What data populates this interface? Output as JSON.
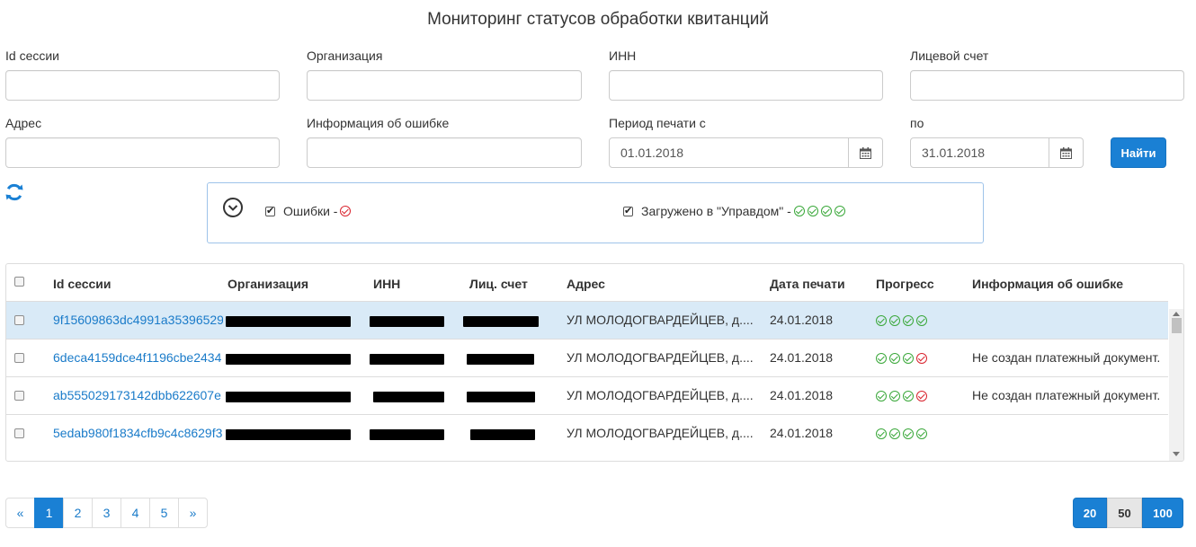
{
  "page": {
    "title": "Мониторинг статусов обработки квитанций"
  },
  "filters": {
    "session_id_label": "Id сессии",
    "org_label": "Организация",
    "inn_label": "ИНН",
    "account_label": "Лицевой счет",
    "address_label": "Адрес",
    "error_info_label": "Информация об ошибке",
    "period_from_label": "Период печати с",
    "period_to_label": "по",
    "date_from": "01.01.2018",
    "date_to": "31.01.2018",
    "find_label": "Найти"
  },
  "legend": {
    "errors_label": "Ошибки -",
    "uploaded_label": "Загружено в \"Управдом\" -"
  },
  "table": {
    "headers": {
      "session_id": "Id сессии",
      "org": "Организация",
      "inn": "ИНН",
      "account": "Лиц. счет",
      "address": "Адрес",
      "print_date": "Дата печати",
      "progress": "Прогресс",
      "error_info": "Информация об ошибке"
    },
    "rows": [
      {
        "session_id": "9f15609863dc4991a35396529",
        "address": "УЛ МОЛОДОГВАРДЕЙЦЕВ, д....",
        "print_date": "24.01.2018",
        "progress": [
          "ok",
          "ok",
          "ok",
          "ok"
        ],
        "error_info": ""
      },
      {
        "session_id": "6deca4159dce4f1196cbe2434",
        "address": "УЛ МОЛОДОГВАРДЕЙЦЕВ, д....",
        "print_date": "24.01.2018",
        "progress": [
          "ok",
          "ok",
          "ok",
          "err"
        ],
        "error_info": "Не создан платежный документ."
      },
      {
        "session_id": "ab555029173142dbb622607e",
        "address": "УЛ МОЛОДОГВАРДЕЙЦЕВ, д....",
        "print_date": "24.01.2018",
        "progress": [
          "ok",
          "ok",
          "ok",
          "err"
        ],
        "error_info": "Не создан платежный документ."
      },
      {
        "session_id": "5edab980f1834cfb9c4c8629f3",
        "address": "УЛ МОЛОДОГВАРДЕЙЦЕВ, д....",
        "print_date": "24.01.2018",
        "progress": [
          "ok",
          "ok",
          "ok",
          "ok"
        ],
        "error_info": ""
      }
    ]
  },
  "pagination": {
    "prev": "«",
    "pages": [
      "1",
      "2",
      "3",
      "4",
      "5"
    ],
    "next": "»",
    "current_page": "1"
  },
  "page_size": {
    "options": [
      "20",
      "50",
      "100"
    ]
  },
  "colors": {
    "accent": "#1a80d4",
    "ok": "#3aa83a",
    "error": "#d9232e",
    "selected_row": "#d9eaf7"
  }
}
